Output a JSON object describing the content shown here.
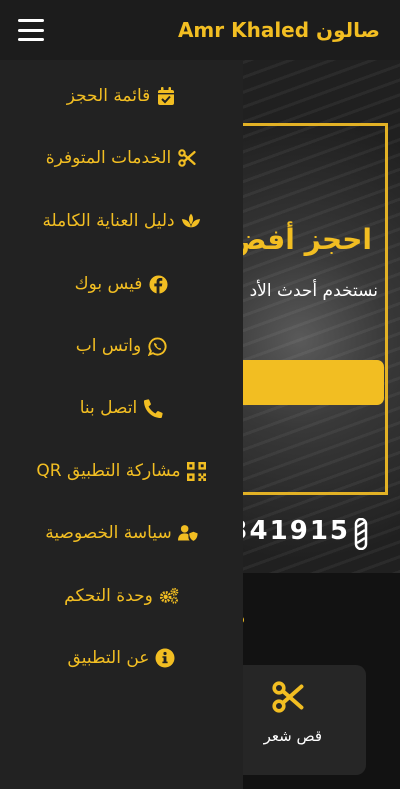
{
  "header": {
    "title": "صالون Amr Khaled",
    "menu_icon": "hamburger-icon"
  },
  "colors": {
    "accent": "#f2be22",
    "header_bg": "#1c1c1c",
    "drawer_bg": "#222222",
    "text": "#ffffff"
  },
  "drawer": {
    "items": [
      {
        "label": "قائمة الحجز",
        "icon": "calendar-check-icon"
      },
      {
        "label": "الخدمات المتوفرة",
        "icon": "scissors-icon"
      },
      {
        "label": "دليل العناية الكاملة",
        "icon": "spa-icon"
      },
      {
        "label": "فيس بوك",
        "icon": "facebook-icon"
      },
      {
        "label": "واتس اب",
        "icon": "whatsapp-icon"
      },
      {
        "label": "اتصل بنا",
        "icon": "phone-icon"
      },
      {
        "label": "مشاركة التطبيق QR",
        "icon": "qrcode-icon"
      },
      {
        "label": "سياسة الخصوصية",
        "icon": "user-shield-icon"
      },
      {
        "label": "وحدة التحكم",
        "icon": "cogs-icon"
      },
      {
        "label": "عن التطبيق",
        "icon": "info-icon"
      }
    ]
  },
  "hero": {
    "title": "احجز أفض",
    "subtitle": "نستخدم أحدث الأد",
    "phone": "341915"
  },
  "services": {
    "card_label": "قص شعر",
    "card_icon": "scissors-icon"
  }
}
